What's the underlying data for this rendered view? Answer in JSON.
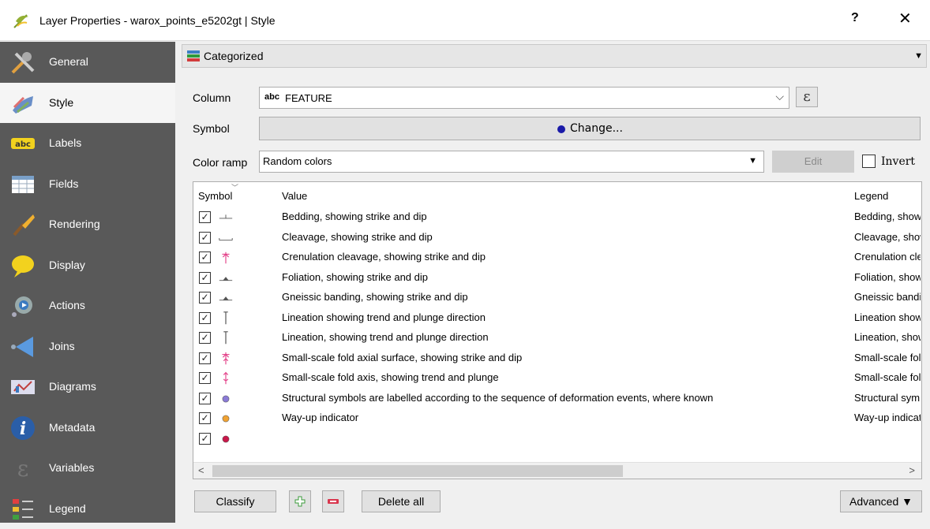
{
  "window": {
    "title": "Layer Properties - warox_points_e5202gt | Style",
    "help_label": "?",
    "close_label": "✕"
  },
  "sidebar": {
    "items": [
      {
        "label": "General",
        "icon": "general-icon"
      },
      {
        "label": "Style",
        "icon": "style-icon"
      },
      {
        "label": "Labels",
        "icon": "labels-icon"
      },
      {
        "label": "Fields",
        "icon": "fields-icon"
      },
      {
        "label": "Rendering",
        "icon": "rendering-icon"
      },
      {
        "label": "Display",
        "icon": "display-icon"
      },
      {
        "label": "Actions",
        "icon": "actions-icon"
      },
      {
        "label": "Joins",
        "icon": "joins-icon"
      },
      {
        "label": "Diagrams",
        "icon": "diagrams-icon"
      },
      {
        "label": "Metadata",
        "icon": "metadata-icon"
      },
      {
        "label": "Variables",
        "icon": "variables-icon"
      },
      {
        "label": "Legend",
        "icon": "legend-icon"
      }
    ],
    "active_index": 1
  },
  "renderer": {
    "value": "Categorized"
  },
  "form": {
    "column_label": "Column",
    "column_type": "abc",
    "column_value": "FEATURE",
    "expression_label": "ε",
    "symbol_label": "Symbol",
    "symbol_button": "Change...",
    "symbol_color": "#1a1aa8",
    "ramp_label": "Color ramp",
    "ramp_value": "Random colors",
    "edit_label": "Edit",
    "invert_label": "Invert"
  },
  "table": {
    "headers": {
      "symbol": "Symbol",
      "value": "Value",
      "legend": "Legend"
    },
    "rows": [
      {
        "symbol": "strike-dip",
        "color": "#555555",
        "value": "Bedding, showing strike and dip",
        "legend": "Bedding, showing strike and dip"
      },
      {
        "symbol": "cleavage",
        "color": "#555555",
        "value": "Cleavage, showing strike and dip",
        "legend": "Cleavage, showing strike and dip"
      },
      {
        "symbol": "crenulation",
        "color": "#e4468c",
        "value": "Crenulation cleavage, showing strike and dip",
        "legend": "Crenulation cleavage, showing strike and dip"
      },
      {
        "symbol": "foliation",
        "color": "#555555",
        "value": "Foliation, showing strike and dip",
        "legend": "Foliation, showing strike and dip"
      },
      {
        "symbol": "foliation",
        "color": "#555555",
        "value": "Gneissic banding, showing strike and dip",
        "legend": "Gneissic banding, showing strike and dip"
      },
      {
        "symbol": "lineation",
        "color": "#555555",
        "value": "Lineation showing trend and plunge direction",
        "legend": "Lineation showing trend and plunge direction"
      },
      {
        "symbol": "lineation",
        "color": "#555555",
        "value": "Lineation, showing trend and plunge direction",
        "legend": "Lineation, showing trend and plunge direction"
      },
      {
        "symbol": "fold-surface",
        "color": "#e4468c",
        "value": "Small-scale fold axial surface, showing strike and dip",
        "legend": "Small-scale fold axial surface, showing strike and dip"
      },
      {
        "symbol": "fold-axis",
        "color": "#e4468c",
        "value": "Small-scale fold axis, showing trend and plunge",
        "legend": "Small-scale fold axis, showing trend and plunge"
      },
      {
        "symbol": "dot",
        "color": "#8a7ad6",
        "value": "Structural symbols are labelled according to the sequence of deformation events, where known",
        "legend": "Structural symbols are labelled according to the sequence of deformation events, where known"
      },
      {
        "symbol": "dot",
        "color": "#f0a232",
        "value": "Way-up indicator",
        "legend": "Way-up indicator"
      },
      {
        "symbol": "dot",
        "color": "#c9184a",
        "value": "",
        "legend": ""
      }
    ]
  },
  "footer": {
    "classify": "Classify",
    "delete_all": "Delete all",
    "advanced": "Advanced ▼"
  }
}
